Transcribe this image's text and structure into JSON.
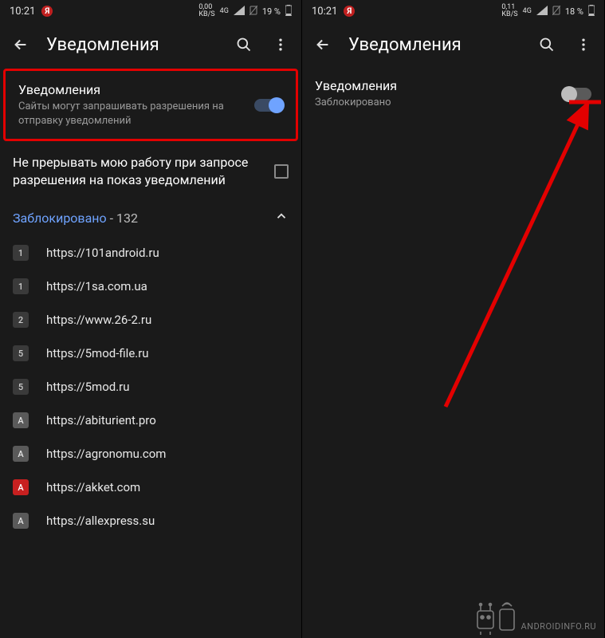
{
  "left": {
    "statusbar": {
      "time": "10:21",
      "data_rate": "0,00",
      "data_unit": "KB/S",
      "network": "4G",
      "battery_pct": "19 %"
    },
    "appbar": {
      "title": "Уведомления"
    },
    "notifications_toggle": {
      "title": "Уведомления",
      "subtitle": "Сайты могут запрашивать разрешения на отправку уведомлений",
      "on": true
    },
    "quiet_setting": {
      "label": "Не прерывать мою работу при запросе разрешения на показ уведомлений"
    },
    "blocked": {
      "label": "Заблокировано",
      "count": "132"
    },
    "sites": [
      {
        "badge": "1",
        "style": "dark",
        "url": "https://101android.ru"
      },
      {
        "badge": "1",
        "style": "dark",
        "url": "https://1sa.com.ua"
      },
      {
        "badge": "2",
        "style": "dark",
        "url": "https://www.26-2.ru"
      },
      {
        "badge": "5",
        "style": "dark",
        "url": "https://5mod-file.ru"
      },
      {
        "badge": "5",
        "style": "dark",
        "url": "https://5mod.ru"
      },
      {
        "badge": "A",
        "style": "gray",
        "url": "https://abiturient.pro"
      },
      {
        "badge": "A",
        "style": "gray",
        "url": "https://agronomu.com"
      },
      {
        "badge": "A",
        "style": "red",
        "url": "https://akket.com"
      },
      {
        "badge": "A",
        "style": "gray",
        "url": "https://allexpress.su"
      }
    ]
  },
  "right": {
    "statusbar": {
      "time": "10:21",
      "data_rate": "0,11",
      "data_unit": "KB/S",
      "network": "4G",
      "battery_pct": "18 %"
    },
    "appbar": {
      "title": "Уведомления"
    },
    "notifications_toggle": {
      "title": "Уведомления",
      "subtitle": "Заблокировано",
      "on": false
    }
  },
  "watermark": "ANDROIDINFO.RU",
  "icons": {
    "yandex": "Я"
  }
}
